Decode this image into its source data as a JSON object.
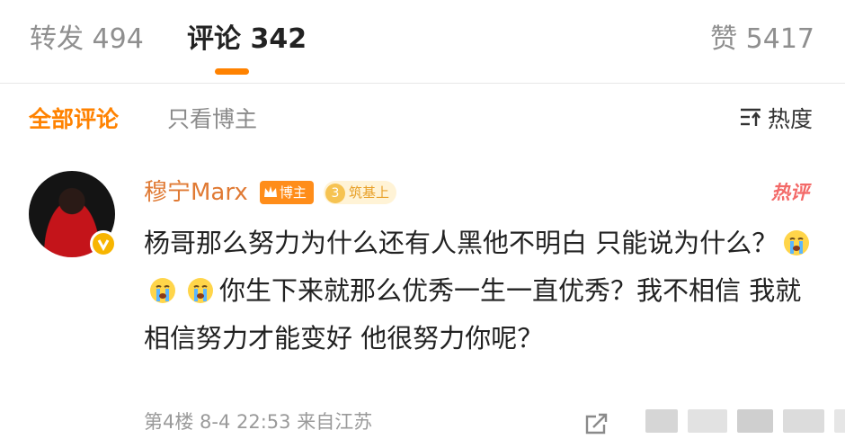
{
  "tabs": {
    "repost": "转发 494",
    "comment": "评论 342",
    "like": "赞 5417"
  },
  "filters": {
    "all": "全部评论",
    "owner_only": "只看博主",
    "sort": "热度"
  },
  "comment": {
    "username": "穆宁Marx",
    "owner_badge": "博主",
    "level_number": "3",
    "level_badge": "筑基上",
    "hot_tag": "热评",
    "text_part1": "杨哥那么努力为什么还有人黑他不明白 只能说为什么？",
    "text_part2": "你生下来就那么优秀一生一直优秀？我不相信 我就相信努力才能变好 他很努力你呢？",
    "emojis": [
      "crying-emoji",
      "crying-emoji",
      "crying-emoji"
    ],
    "meta": "第4楼  8-4 22:53  来自江苏"
  },
  "colors": {
    "accent": "#ff8200",
    "username": "#e07a34",
    "hot": "#f36a68",
    "muted": "#9a9a9a"
  }
}
